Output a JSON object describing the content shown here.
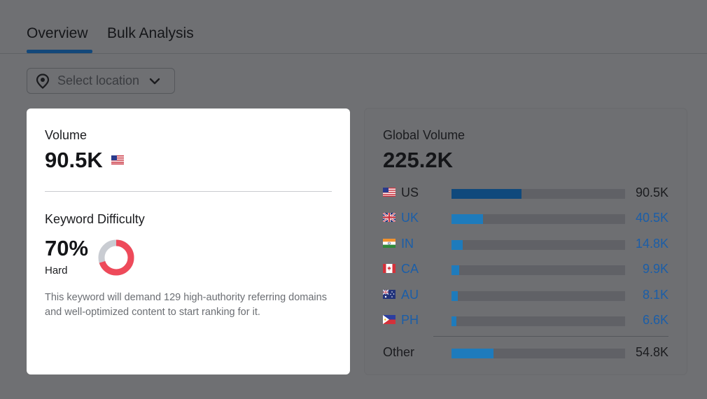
{
  "tabs": [
    {
      "label": "Overview",
      "active": true
    },
    {
      "label": "Bulk Analysis",
      "active": false
    }
  ],
  "location": {
    "placeholder": "Select location",
    "icon": "map-pin-icon"
  },
  "volume_card": {
    "volume_label": "Volume",
    "volume_value": "90.5K",
    "volume_flag": "us-flag-icon",
    "kd_label": "Keyword Difficulty",
    "kd_value": "70%",
    "kd_percent": 70,
    "kd_level": "Hard",
    "kd_color": "#ee4a5a",
    "kd_track_color": "#c9ccd2",
    "description": "This keyword will demand 129 high-authority referring domains and well-optimized content to start ranking for it."
  },
  "global_card": {
    "label": "Global Volume",
    "value": "225.2K",
    "countries": [
      {
        "code": "US",
        "value": "90.5K",
        "fraction": 0.402,
        "flag": "us-flag-icon",
        "color": "#10497c",
        "link": false
      },
      {
        "code": "UK",
        "value": "40.5K",
        "fraction": 0.18,
        "flag": "uk-flag-icon",
        "color": "#1e7bbc",
        "link": true
      },
      {
        "code": "IN",
        "value": "14.8K",
        "fraction": 0.066,
        "flag": "in-flag-icon",
        "color": "#1e7bbc",
        "link": true
      },
      {
        "code": "CA",
        "value": "9.9K",
        "fraction": 0.044,
        "flag": "ca-flag-icon",
        "color": "#1e7bbc",
        "link": true
      },
      {
        "code": "AU",
        "value": "8.1K",
        "fraction": 0.036,
        "flag": "au-flag-icon",
        "color": "#1e7bbc",
        "link": true
      },
      {
        "code": "PH",
        "value": "6.6K",
        "fraction": 0.029,
        "flag": "ph-flag-icon",
        "color": "#1e7bbc",
        "link": true
      }
    ],
    "other": {
      "label": "Other",
      "value": "54.8K",
      "fraction": 0.243,
      "color": "#1e7bbc"
    }
  }
}
